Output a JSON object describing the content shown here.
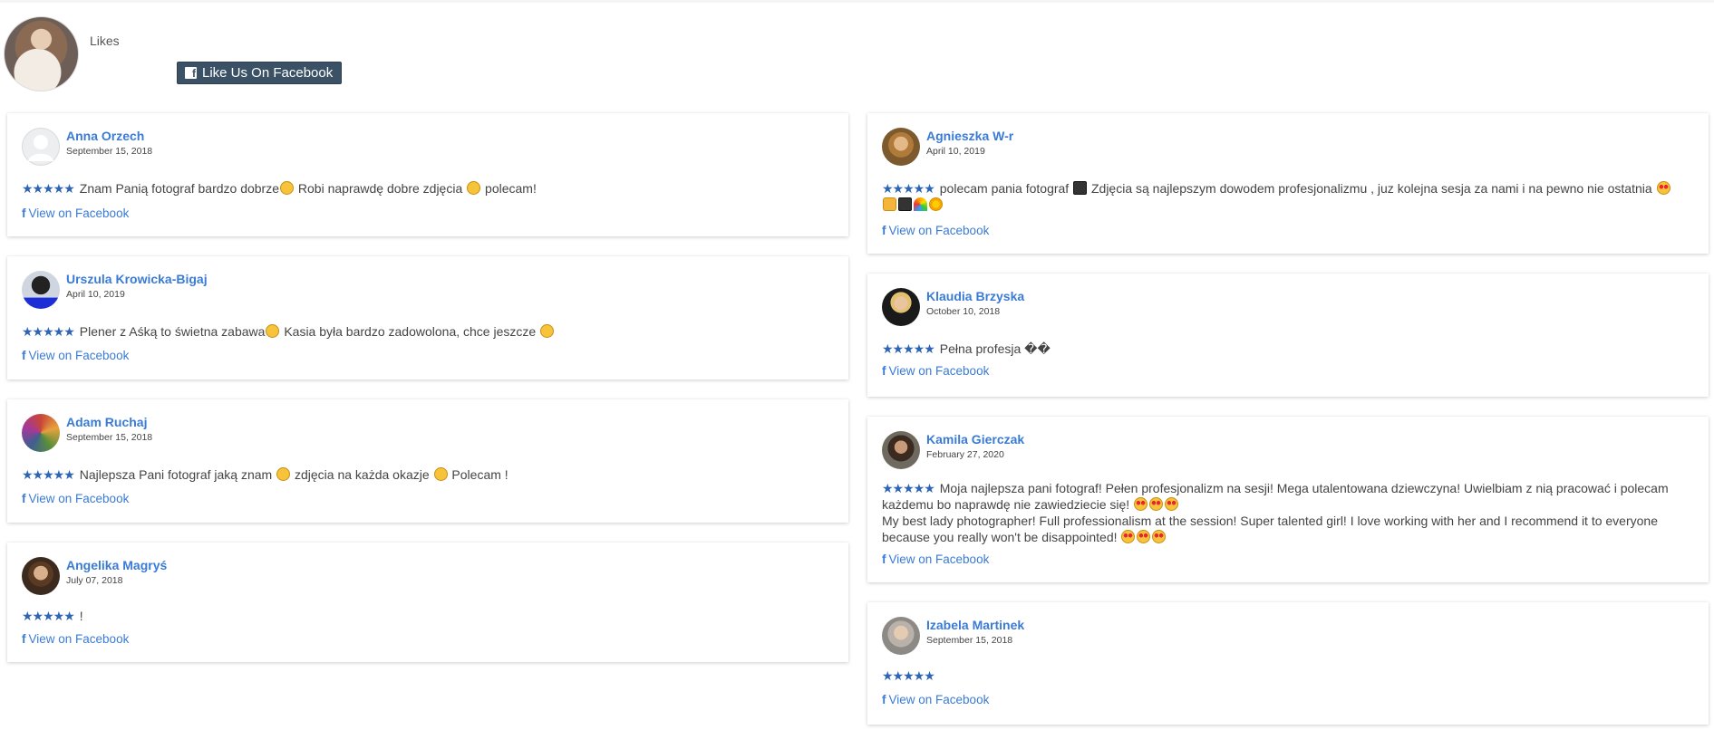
{
  "header": {
    "likes_label": "Likes",
    "like_button": "Like Us On Facebook",
    "page_avatar_icon": "page-profile-photo"
  },
  "view_label": "View on Facebook",
  "stars": "★★★★★",
  "left_reviews": [
    {
      "name": "Anna Orzech",
      "date": "September 15, 2018",
      "text_a": "Znam Panią fotograf bardzo dobrze",
      "text_b": " Robi naprawdę dobre zdjęcia ",
      "text_c": " polecam!"
    },
    {
      "name": "Urszula Krowicka-Bigaj",
      "date": "April 10, 2019",
      "text_a": "Plener z Aśką to świetna zabawa",
      "text_b": " Kasia była bardzo zadowolona, chce jeszcze ",
      "text_c": ""
    },
    {
      "name": "Adam Ruchaj",
      "date": "September 15, 2018",
      "text_a": "Najlepsza Pani fotograf jaką znam ",
      "text_b": " zdjęcia na każda okazje ",
      "text_c": " Polecam !"
    },
    {
      "name": "Angelika Magryś",
      "date": "July 07, 2018",
      "text_a": "!",
      "text_b": "",
      "text_c": ""
    }
  ],
  "right_reviews": [
    {
      "name": "Agnieszka W-r",
      "date": "April 10, 2019",
      "text_a": "polecam pania fotograf ",
      "text_b": " Zdjęcia są najlepszym dowodem profesjonalizmu , juz kolejna sesja za nami i na pewno nie ostatnia "
    },
    {
      "name": "Klaudia Brzyska",
      "date": "October 10, 2018",
      "text_a": "Pełna profesja ��"
    },
    {
      "name": "Kamila Gierczak",
      "date": "February 27, 2020",
      "text_a": "Moja najlepsza pani fotograf! Pełen profesjonalizm na sesji! Mega utalentowana dziewczyna! Uwielbiam z nią pracować i polecam każdemu bo naprawdę nie zawiedziecie się! ",
      "text_b": "My best lady photographer! Full professionalism at the session! Super talented girl! I love working with her and I recommend it to everyone because you really won't be disappointed! "
    },
    {
      "name": "Izabela Martinek",
      "date": "September 15, 2018",
      "text_a": ""
    }
  ],
  "colors": {
    "accent": "#3a7bd5",
    "stars": "#2d64b4",
    "fb_button": "#3b5166"
  }
}
